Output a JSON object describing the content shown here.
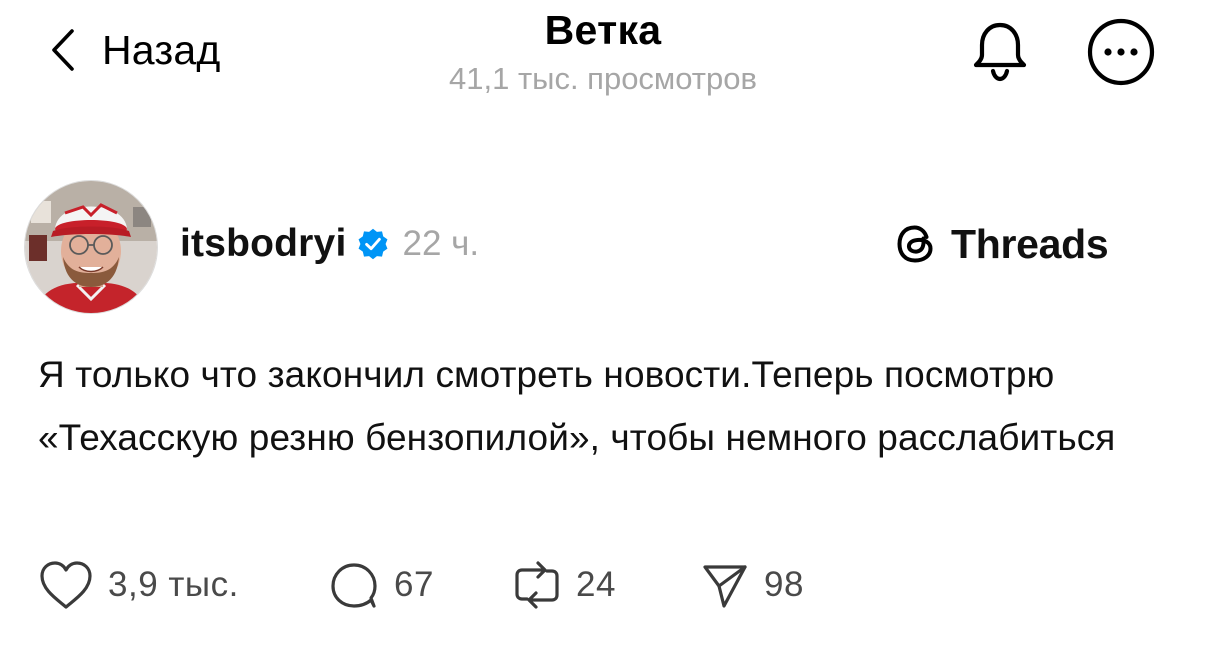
{
  "header": {
    "back_label": "Назад",
    "title": "Ветка",
    "subtitle": "41,1 тыс. просмотров"
  },
  "post": {
    "username": "itsbodryi",
    "verified": true,
    "time": "22 ч.",
    "text": "Я только что закончил смотреть новости.Теперь посмотрю «Техасскую резню бензопилой», чтобы немного расслабиться"
  },
  "brand": {
    "label": "Threads"
  },
  "actions": {
    "likes": "3,9 тыс.",
    "comments": "67",
    "reposts": "24",
    "shares": "98"
  },
  "icons": {
    "back": "chevron-left-icon",
    "notifications": "bell-icon",
    "more": "more-horizontal-icon",
    "verified": "verified-badge-icon",
    "brand": "threads-logo-icon",
    "like": "heart-icon",
    "comment": "comment-icon",
    "repost": "repost-icon",
    "share": "send-icon"
  },
  "colors": {
    "text": "#000000",
    "secondary_text": "#a6a6a6",
    "verified_blue": "#0095f6",
    "background": "#ffffff"
  }
}
